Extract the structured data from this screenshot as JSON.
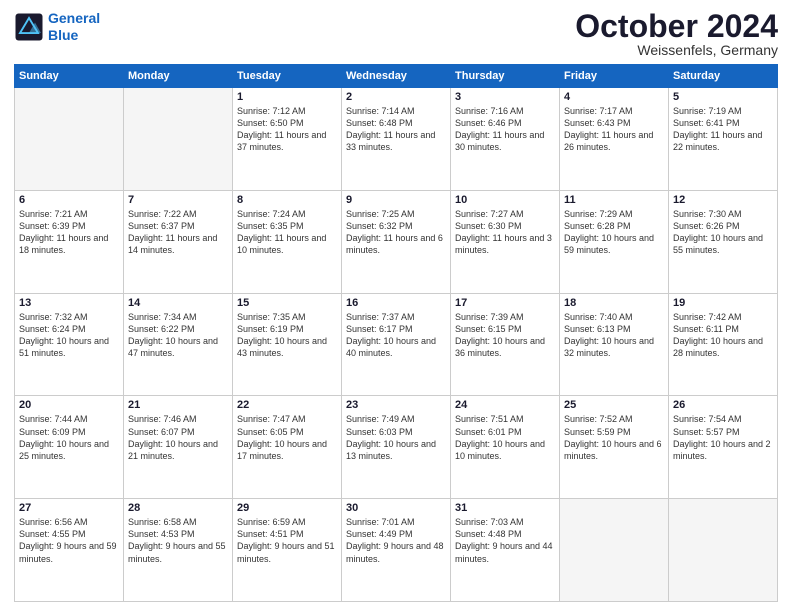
{
  "header": {
    "logo": {
      "line1": "General",
      "line2": "Blue"
    },
    "title": "October 2024",
    "location": "Weissenfels, Germany"
  },
  "weekdays": [
    "Sunday",
    "Monday",
    "Tuesday",
    "Wednesday",
    "Thursday",
    "Friday",
    "Saturday"
  ],
  "weeks": [
    [
      {
        "day": "",
        "empty": true
      },
      {
        "day": "",
        "empty": true
      },
      {
        "day": "1",
        "sunrise": "7:12 AM",
        "sunset": "6:50 PM",
        "daylight": "11 hours and 37 minutes."
      },
      {
        "day": "2",
        "sunrise": "7:14 AM",
        "sunset": "6:48 PM",
        "daylight": "11 hours and 33 minutes."
      },
      {
        "day": "3",
        "sunrise": "7:16 AM",
        "sunset": "6:46 PM",
        "daylight": "11 hours and 30 minutes."
      },
      {
        "day": "4",
        "sunrise": "7:17 AM",
        "sunset": "6:43 PM",
        "daylight": "11 hours and 26 minutes."
      },
      {
        "day": "5",
        "sunrise": "7:19 AM",
        "sunset": "6:41 PM",
        "daylight": "11 hours and 22 minutes."
      }
    ],
    [
      {
        "day": "6",
        "sunrise": "7:21 AM",
        "sunset": "6:39 PM",
        "daylight": "11 hours and 18 minutes."
      },
      {
        "day": "7",
        "sunrise": "7:22 AM",
        "sunset": "6:37 PM",
        "daylight": "11 hours and 14 minutes."
      },
      {
        "day": "8",
        "sunrise": "7:24 AM",
        "sunset": "6:35 PM",
        "daylight": "11 hours and 10 minutes."
      },
      {
        "day": "9",
        "sunrise": "7:25 AM",
        "sunset": "6:32 PM",
        "daylight": "11 hours and 6 minutes."
      },
      {
        "day": "10",
        "sunrise": "7:27 AM",
        "sunset": "6:30 PM",
        "daylight": "11 hours and 3 minutes."
      },
      {
        "day": "11",
        "sunrise": "7:29 AM",
        "sunset": "6:28 PM",
        "daylight": "10 hours and 59 minutes."
      },
      {
        "day": "12",
        "sunrise": "7:30 AM",
        "sunset": "6:26 PM",
        "daylight": "10 hours and 55 minutes."
      }
    ],
    [
      {
        "day": "13",
        "sunrise": "7:32 AM",
        "sunset": "6:24 PM",
        "daylight": "10 hours and 51 minutes."
      },
      {
        "day": "14",
        "sunrise": "7:34 AM",
        "sunset": "6:22 PM",
        "daylight": "10 hours and 47 minutes."
      },
      {
        "day": "15",
        "sunrise": "7:35 AM",
        "sunset": "6:19 PM",
        "daylight": "10 hours and 43 minutes."
      },
      {
        "day": "16",
        "sunrise": "7:37 AM",
        "sunset": "6:17 PM",
        "daylight": "10 hours and 40 minutes."
      },
      {
        "day": "17",
        "sunrise": "7:39 AM",
        "sunset": "6:15 PM",
        "daylight": "10 hours and 36 minutes."
      },
      {
        "day": "18",
        "sunrise": "7:40 AM",
        "sunset": "6:13 PM",
        "daylight": "10 hours and 32 minutes."
      },
      {
        "day": "19",
        "sunrise": "7:42 AM",
        "sunset": "6:11 PM",
        "daylight": "10 hours and 28 minutes."
      }
    ],
    [
      {
        "day": "20",
        "sunrise": "7:44 AM",
        "sunset": "6:09 PM",
        "daylight": "10 hours and 25 minutes."
      },
      {
        "day": "21",
        "sunrise": "7:46 AM",
        "sunset": "6:07 PM",
        "daylight": "10 hours and 21 minutes."
      },
      {
        "day": "22",
        "sunrise": "7:47 AM",
        "sunset": "6:05 PM",
        "daylight": "10 hours and 17 minutes."
      },
      {
        "day": "23",
        "sunrise": "7:49 AM",
        "sunset": "6:03 PM",
        "daylight": "10 hours and 13 minutes."
      },
      {
        "day": "24",
        "sunrise": "7:51 AM",
        "sunset": "6:01 PM",
        "daylight": "10 hours and 10 minutes."
      },
      {
        "day": "25",
        "sunrise": "7:52 AM",
        "sunset": "5:59 PM",
        "daylight": "10 hours and 6 minutes."
      },
      {
        "day": "26",
        "sunrise": "7:54 AM",
        "sunset": "5:57 PM",
        "daylight": "10 hours and 2 minutes."
      }
    ],
    [
      {
        "day": "27",
        "sunrise": "6:56 AM",
        "sunset": "4:55 PM",
        "daylight": "9 hours and 59 minutes."
      },
      {
        "day": "28",
        "sunrise": "6:58 AM",
        "sunset": "4:53 PM",
        "daylight": "9 hours and 55 minutes."
      },
      {
        "day": "29",
        "sunrise": "6:59 AM",
        "sunset": "4:51 PM",
        "daylight": "9 hours and 51 minutes."
      },
      {
        "day": "30",
        "sunrise": "7:01 AM",
        "sunset": "4:49 PM",
        "daylight": "9 hours and 48 minutes."
      },
      {
        "day": "31",
        "sunrise": "7:03 AM",
        "sunset": "4:48 PM",
        "daylight": "9 hours and 44 minutes."
      },
      {
        "day": "",
        "empty": true
      },
      {
        "day": "",
        "empty": true
      }
    ]
  ]
}
